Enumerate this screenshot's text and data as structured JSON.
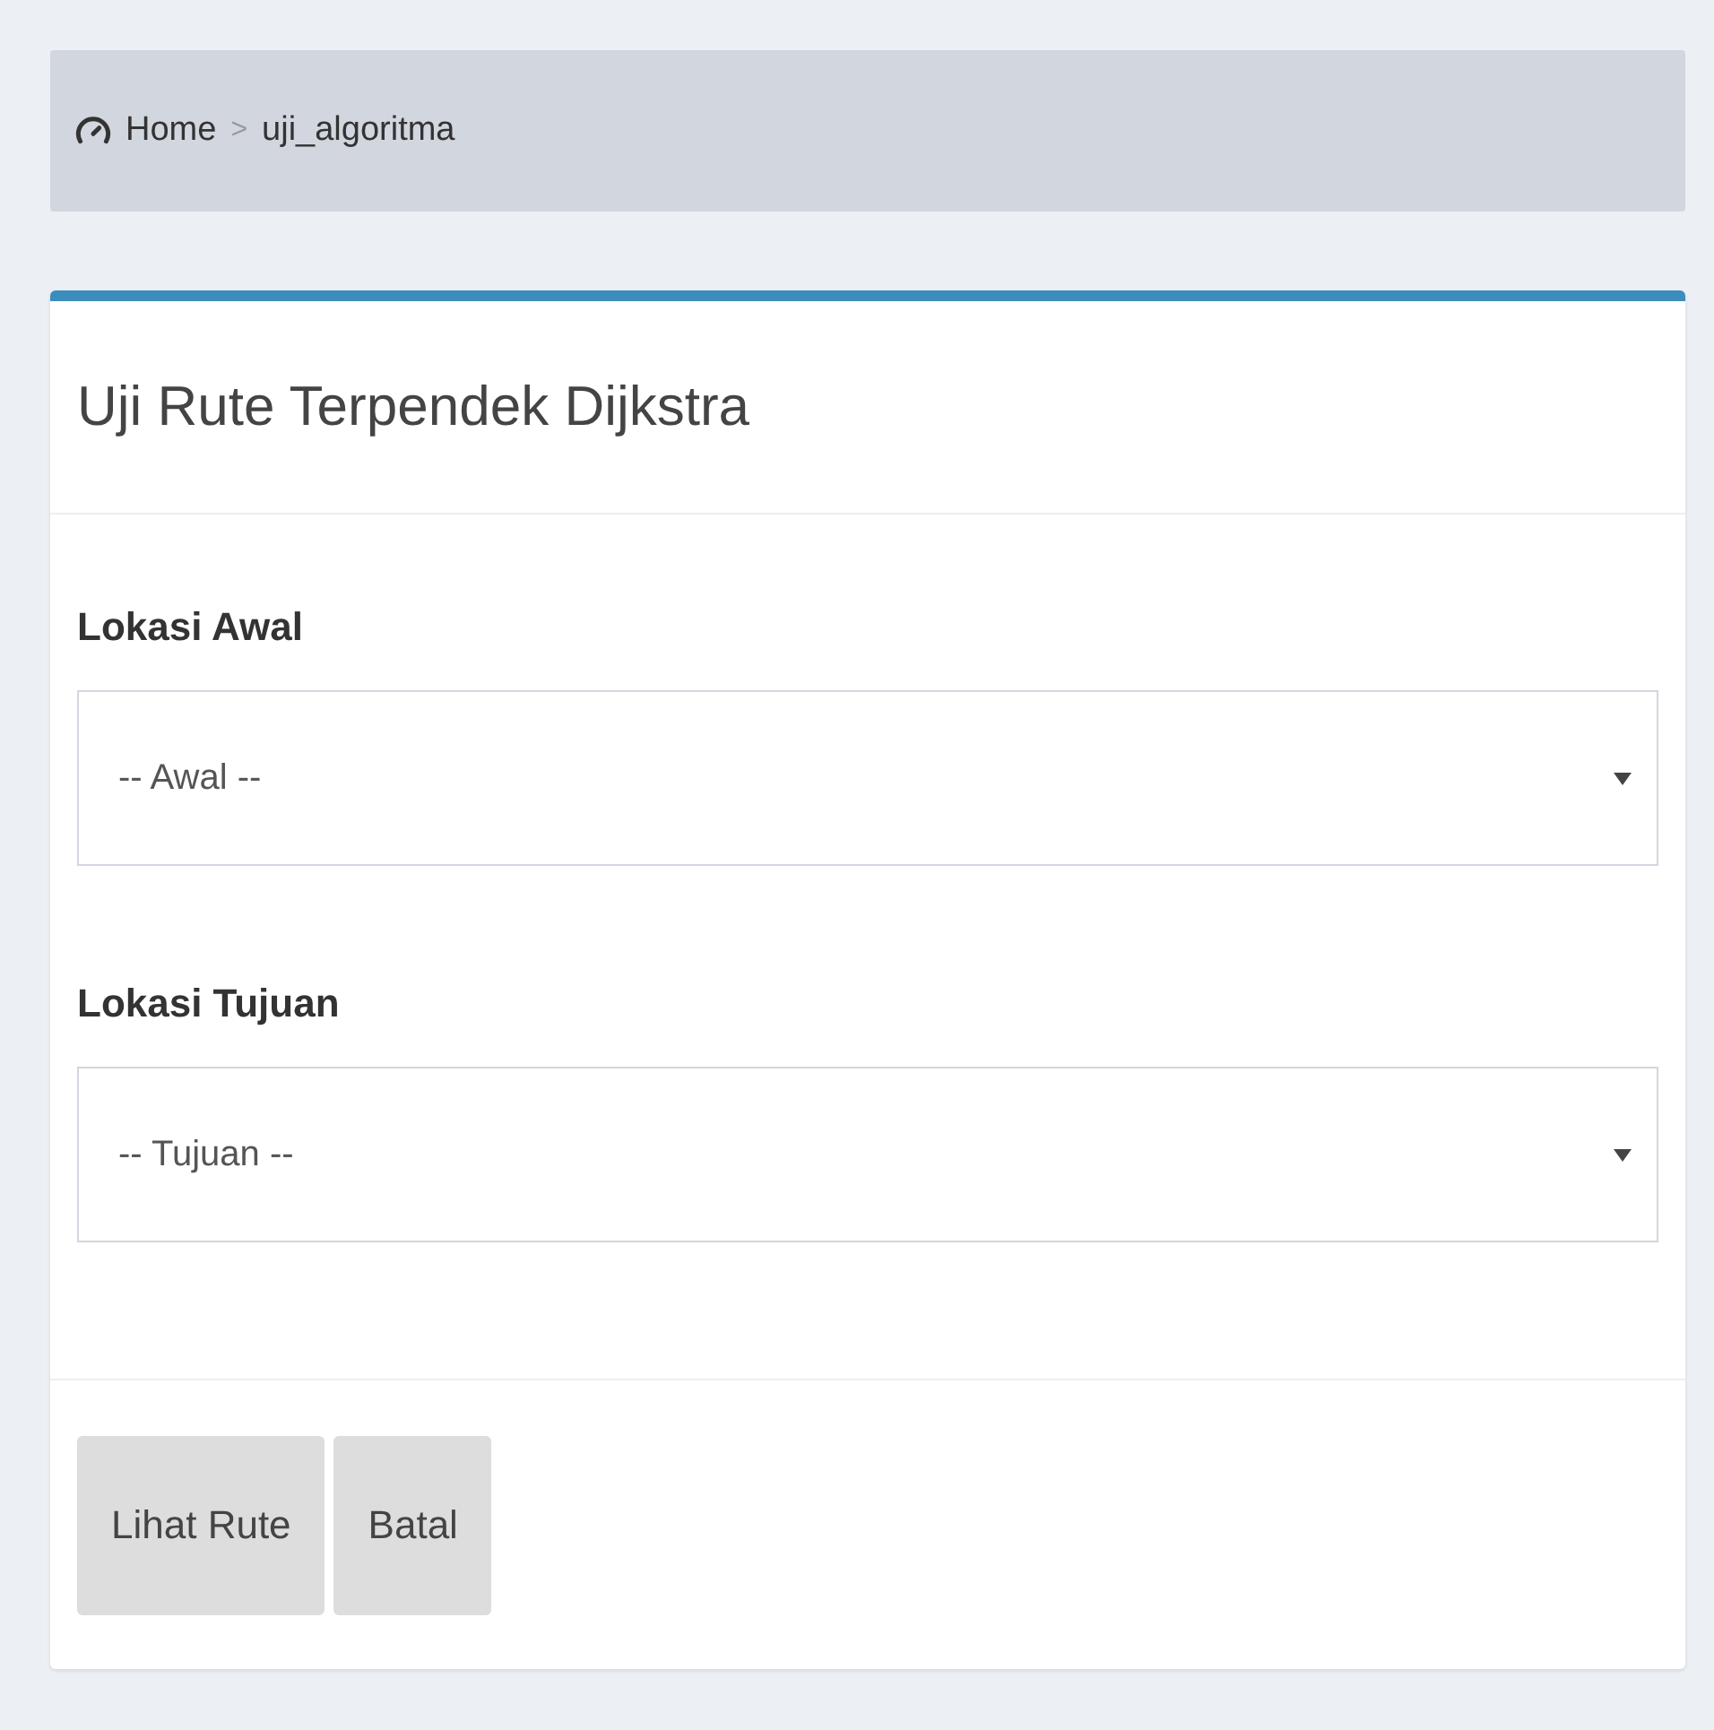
{
  "breadcrumb_separator": ">",
  "breadcrumb": [
    {
      "label": "Home",
      "kind": "home"
    },
    {
      "label": "uji_algoritma",
      "kind": "page"
    }
  ],
  "box": {
    "title": "Uji Rute Terpendek Dijkstra",
    "fields": [
      {
        "label": "Lokasi Awal",
        "value": "-- Awal --"
      },
      {
        "label": "Lokasi Tujuan",
        "value": "-- Tujuan --"
      }
    ],
    "buttons": [
      "Lihat Rute",
      "Batal"
    ]
  }
}
